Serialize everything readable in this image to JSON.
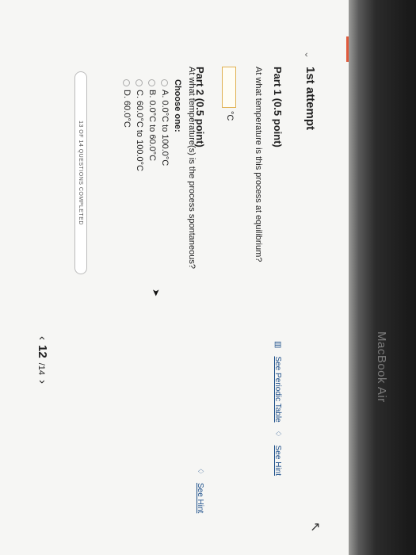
{
  "attempt": {
    "chevron": "⌄",
    "title": "1st attempt",
    "expand_icon": "↖"
  },
  "part1": {
    "title": "Part 1   (0.5 point)",
    "periodic_table_label": "See Periodic Table",
    "hint_label": "See Hint",
    "question": "At what temperature is this process at equilibrium?",
    "unit": "°C",
    "answer_value": ""
  },
  "part2": {
    "title": "Part 2   (0.5 point)",
    "hint_label": "See Hint",
    "question": "At what temperature(s) is the process spontaneous?",
    "choose_label": "Choose one:",
    "options": [
      "A.  0.0°C to 100.0°C",
      "B.  0.0°C to 60.0°C",
      "C.  60.0°C to 100.0°C",
      "D.  60.0°C"
    ]
  },
  "progress": {
    "label": "13 OF 14 QUESTIONS COMPLETED",
    "completed": 13,
    "total": 14
  },
  "pager": {
    "prev": "‹",
    "current": "12",
    "total": "/14",
    "next": "›"
  },
  "device": {
    "brand": "MacBook Air"
  },
  "colors": {
    "accent": "#e05a3c",
    "link": "#1d4f8a",
    "input_border": "#e0b050"
  }
}
